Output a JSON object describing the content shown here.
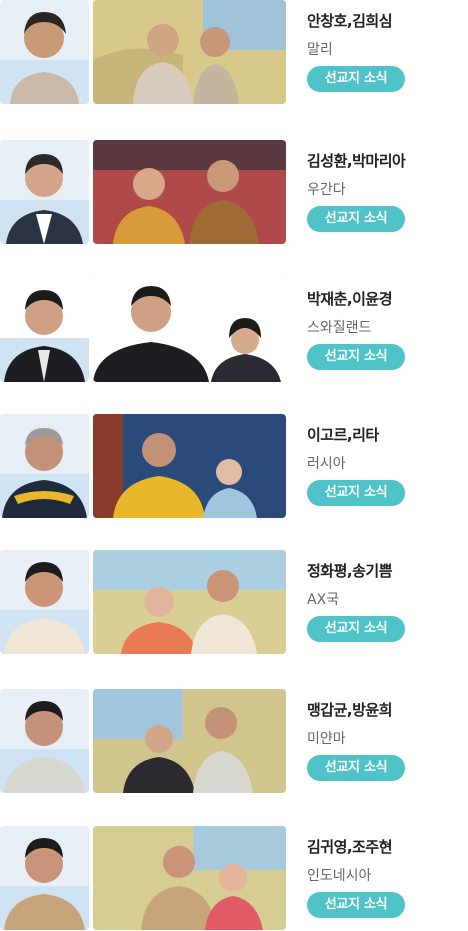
{
  "missionaries": [
    {
      "name": "안창호,김희심",
      "country": "말리",
      "button": "선교지 소식",
      "photo_bg": "#d8c98a"
    },
    {
      "name": "김성환,박마리아",
      "country": "우간다",
      "button": "선교지 소식",
      "photo_bg": "#b04a4a"
    },
    {
      "name": "박재춘,이윤경",
      "country": "스와질랜드",
      "button": "선교지 소식",
      "photo_bg": "#ffffff"
    },
    {
      "name": "이고르,리타",
      "country": "러시아",
      "button": "선교지 소식",
      "photo_bg": "#2a4a7a"
    },
    {
      "name": "정화평,송기쁨",
      "country": "AX국",
      "button": "선교지 소식",
      "photo_bg": "#d9cf95"
    },
    {
      "name": "맹갑균,방윤희",
      "country": "미얀마",
      "button": "선교지 소식",
      "photo_bg": "#cfc58d"
    },
    {
      "name": "김귀영,조주현",
      "country": "인도네시아",
      "button": "선교지 소식",
      "photo_bg": "#d6cd92"
    }
  ],
  "colors": {
    "button": "#4fc3c8",
    "name": "#222222",
    "country": "#666666"
  }
}
